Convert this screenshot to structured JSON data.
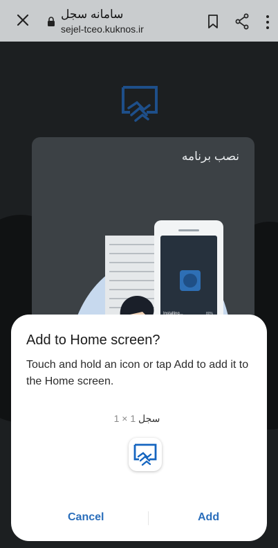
{
  "browser": {
    "site_title": "سامانه سجل",
    "url": "sejel-tceo.kuknos.ir"
  },
  "page": {
    "install_card_title": "نصب برنامه",
    "install_status": "Installing...",
    "install_percent": "80%",
    "install_progress": 0.8
  },
  "dialog": {
    "title": "Add to Home screen?",
    "description": "Touch and hold an icon or tap Add to add it to the Home screen.",
    "app_name": "سجل",
    "app_size": "1 × 1",
    "cancel_label": "Cancel",
    "add_label": "Add"
  },
  "colors": {
    "accent": "#2a6ebb",
    "topbar": "#c9ccce",
    "logo_blue": "#1565c0"
  }
}
